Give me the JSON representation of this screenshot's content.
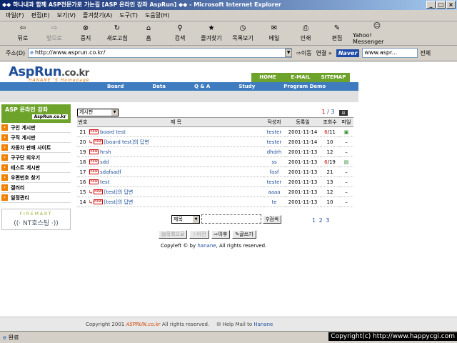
{
  "window": {
    "title": "◆◆ 하나내과 함께 ASP전문가로 가는길 [ASP 온라인 강좌 AspRun] ◆◆ - Microsoft Internet Explorer",
    "controls": [
      "_",
      "□",
      "×"
    ]
  },
  "menubar": {
    "items": [
      "파일(F)",
      "편집(E)",
      "보기(V)",
      "즐겨찾기(A)",
      "도구(T)",
      "도움말(H)"
    ]
  },
  "toolbar": {
    "back": "뒤로",
    "forward": "앞으로",
    "stop": "중지",
    "refresh": "새로고침",
    "home": "홈",
    "search": "검색",
    "favorites": "즐겨찾기",
    "history": "목록보기",
    "mail": "메일",
    "print": "인쇄",
    "edit": "편집",
    "messenger": "Yahoo! Messenger"
  },
  "addressbar": {
    "label": "주소(D)",
    "url": "http://www.asprun.co.kr/",
    "go": "이동",
    "links": "연결 »",
    "naver": "Naver",
    "naver_value": "www.aspr...",
    "naver_scope": "전체"
  },
  "site": {
    "logo": "AspRun",
    "logo_suffix": ".co.kr",
    "tagline": "HANANE 'S Homepage",
    "top_links": [
      "HOME",
      "E-MAIL",
      "SITEMAP"
    ],
    "nav": [
      "Board",
      "Data",
      "Q & A",
      "Study",
      "Program Demo"
    ]
  },
  "sidebar": {
    "head": "ASP 온라인 강좌",
    "head_sub": "AspRun.co.kr",
    "items": [
      "구인 게시판",
      "구직 게시판",
      "자동차 판매 사이트",
      "구구단 외우기",
      "테스트 게시판",
      "우편번호 찾기",
      "갤러리",
      "일정관리"
    ],
    "banner_top": "FIREMART",
    "banner_main": "((· NT호스팅 ·))"
  },
  "board": {
    "category": "게시판",
    "page_current": "1",
    "page_total": "/ 3",
    "columns": [
      "번호",
      "제    목",
      "작성자",
      "등록일",
      "조회수",
      "파일"
    ],
    "rows": [
      {
        "no": "21",
        "reply": "",
        "title": "board test",
        "writer": "tester",
        "date": "2001-11-14",
        "hits_hot": "6",
        "hits": "/11",
        "file": "▣"
      },
      {
        "no": "20",
        "reply": "↳",
        "title": "[board test]의 답변",
        "writer": "tester",
        "date": "2001-11-14",
        "hits_hot": "",
        "hits": "10",
        "file": "–"
      },
      {
        "no": "19",
        "reply": "",
        "title": "hrsh",
        "writer": "dhdrh",
        "date": "2001-11-13",
        "hits_hot": "",
        "hits": "12",
        "file": "–"
      },
      {
        "no": "18",
        "reply": "",
        "title": "sdd",
        "writer": "ss",
        "date": "2001-11-13",
        "hits_hot": "6",
        "hits": "/19",
        "file": "▤"
      },
      {
        "no": "17",
        "reply": "",
        "title": "sdafsadf",
        "writer": "fasf",
        "date": "2001-11-13",
        "hits_hot": "",
        "hits": "21",
        "file": "–"
      },
      {
        "no": "16",
        "reply": "",
        "title": "test",
        "writer": "tester",
        "date": "2001-11-13",
        "hits_hot": "",
        "hits": "13",
        "file": "–"
      },
      {
        "no": "15",
        "reply": "↳",
        "title": "[test]의 답변",
        "writer": "aaaa",
        "date": "2001-11-13",
        "hits_hot": "",
        "hits": "12",
        "file": "–"
      },
      {
        "no": "14",
        "reply": "↳",
        "title": "[test]의 답변",
        "writer": "te",
        "date": "2001-11-13",
        "hits_hot": "",
        "hits": "10",
        "file": "–"
      }
    ],
    "new_badge": "new",
    "search_field": "제목",
    "search_button": "검색",
    "pages": "1 2 3",
    "btn_list": "목록으로",
    "btn_prev": "이전",
    "btn_next": "이후",
    "btn_write": "글쓰기",
    "copyleft_pre": "Copyleft © by",
    "copyleft_name": "hanane",
    "copyleft_post": ", All rights reserved."
  },
  "footer": {
    "pre": "Copyright 2001",
    "asp": "ASPRUN.co.kr",
    "post": "All rights reserved.",
    "mail": "✉ Help Mail to",
    "name": "Hanane"
  },
  "statusbar": {
    "text": "완료",
    "copyright": "Copyright(c) http://www.happycgi.com"
  }
}
